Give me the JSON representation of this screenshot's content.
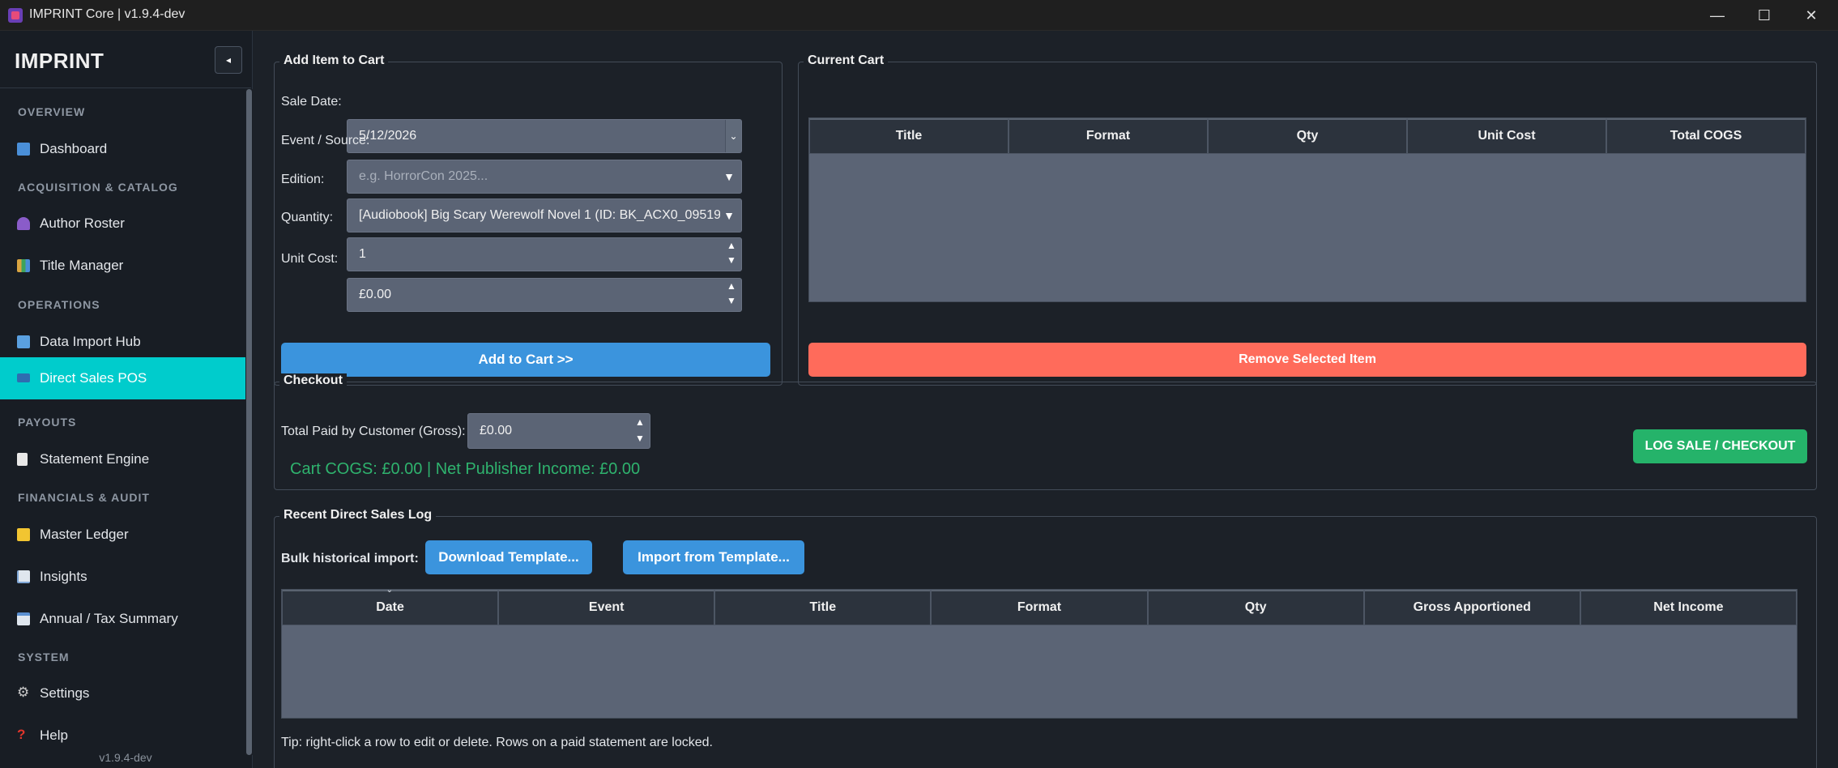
{
  "window": {
    "title": "IMPRINT Core | v1.9.4-dev",
    "controls": {
      "minimize": "—",
      "maximize": "☐",
      "close": "✕"
    }
  },
  "sidebar": {
    "brand": "IMPRINT",
    "collapse_glyph": "◂",
    "version": "v1.9.4-dev",
    "sections": [
      {
        "heading": "OVERVIEW",
        "items": [
          {
            "label": "Dashboard",
            "icon": "bar-chart-icon",
            "color": "#4a8fd8"
          }
        ]
      },
      {
        "heading": "ACQUISITION & CATALOG",
        "items": [
          {
            "label": "Author Roster",
            "icon": "person-icon",
            "color": "#8a5cc9"
          },
          {
            "label": "Title Manager",
            "icon": "books-icon",
            "color": "#d9a441"
          }
        ]
      },
      {
        "heading": "OPERATIONS",
        "items": [
          {
            "label": "Data Import Hub",
            "icon": "inbox-icon",
            "color": "#5aa0e0"
          },
          {
            "label": "Direct Sales POS",
            "icon": "credit-card-icon",
            "color": "#2e6db0",
            "active": true
          }
        ]
      },
      {
        "heading": "PAYOUTS",
        "items": [
          {
            "label": "Statement Engine",
            "icon": "document-icon",
            "color": "#e8e8e8"
          }
        ]
      },
      {
        "heading": "FINANCIALS & AUDIT",
        "items": [
          {
            "label": "Master Ledger",
            "icon": "ledger-icon",
            "color": "#f2c531"
          },
          {
            "label": "Insights",
            "icon": "trend-chart-icon",
            "color": "#7fa7d6"
          },
          {
            "label": "Annual / Tax Summary",
            "icon": "calendar-icon",
            "color": "#5a8fd0"
          }
        ]
      },
      {
        "heading": "SYSTEM",
        "items": [
          {
            "label": "Settings",
            "icon": "gear-icon",
            "color": "#c9c9c9"
          },
          {
            "label": "Help",
            "icon": "question-icon",
            "color": "#e0352b"
          }
        ]
      }
    ]
  },
  "add_item": {
    "title": "Add Item to Cart",
    "sale_date_label": "Sale Date:",
    "sale_date_value": "5/12/2026",
    "event_label": "Event / Source:",
    "event_placeholder": "e.g. HorrorCon 2025...",
    "edition_label": "Edition:",
    "edition_value": "[Audiobook]  Big Scary Werewolf Novel 1  (ID: BK_ACX0_09519",
    "quantity_label": "Quantity:",
    "quantity_value": "1",
    "unit_cost_label": "Unit Cost:",
    "unit_cost_value": "£0.00",
    "add_button": "Add to Cart >>"
  },
  "cart": {
    "title": "Current Cart",
    "columns": [
      "Title",
      "Format",
      "Qty",
      "Unit Cost",
      "Total COGS"
    ],
    "remove_button": "Remove Selected Item"
  },
  "checkout": {
    "title": "Checkout",
    "total_paid_label": "Total Paid by Customer (Gross):",
    "total_paid_value": "£0.00",
    "summary": "Cart COGS: £0.00  |  Net Publisher Income: £0.00",
    "log_button": "LOG SALE / CHECKOUT"
  },
  "log": {
    "title": "Recent Direct Sales Log",
    "bulk_label": "Bulk historical import:",
    "download_button": "Download Template...",
    "import_button": "Import from Template...",
    "columns": [
      "Date",
      "Event",
      "Title",
      "Format",
      "Qty",
      "Gross Apportioned",
      "Net Income"
    ],
    "sort_glyph": "⌄",
    "tip": "Tip: right-click a row to edit or delete. Rows on a paid statement are locked."
  }
}
